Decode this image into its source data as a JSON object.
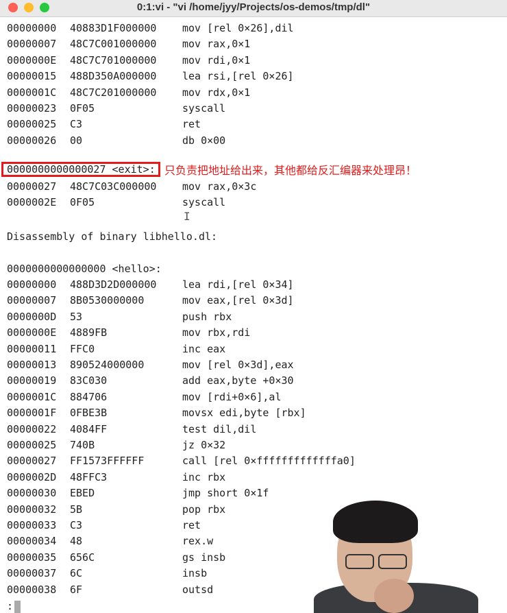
{
  "window": {
    "title": "0:1:vi - \"vi /home/jyy/Projects/os-demos/tmp/dl\""
  },
  "colors": {
    "close": "#fe5f57",
    "minimize": "#febc2e",
    "maximize": "#28c840",
    "annotation": "#e21b1b"
  },
  "section1_rows": [
    {
      "addr": "00000000",
      "bytes": "40883D1F000000",
      "asm": "mov [rel 0×26],dil"
    },
    {
      "addr": "00000007",
      "bytes": "48C7C001000000",
      "asm": "mov rax,0×1"
    },
    {
      "addr": "0000000E",
      "bytes": "48C7C701000000",
      "asm": "mov rdi,0×1"
    },
    {
      "addr": "00000015",
      "bytes": "488D350A000000",
      "asm": "lea rsi,[rel 0×26]"
    },
    {
      "addr": "0000001C",
      "bytes": "48C7C201000000",
      "asm": "mov rdx,0×1"
    },
    {
      "addr": "00000023",
      "bytes": "0F05",
      "asm": "syscall"
    },
    {
      "addr": "00000025",
      "bytes": "C3",
      "asm": "ret"
    },
    {
      "addr": "00000026",
      "bytes": "00",
      "asm": "db 0×00"
    }
  ],
  "exit_label": "0000000000000027 <exit>:",
  "annotation": "只负责把地址给出来，其他都给反汇编器来处理昂！",
  "section2_rows": [
    {
      "addr": "00000027",
      "bytes": "48C7C03C000000",
      "asm": "mov rax,0×3c"
    },
    {
      "addr": "0000002E",
      "bytes": "0F05",
      "asm": "syscall"
    }
  ],
  "disasm_header": "Disassembly of binary libhello.dl:",
  "hello_label": "0000000000000000 <hello>:",
  "hello_rows": [
    {
      "addr": "00000000",
      "bytes": "488D3D2D000000",
      "asm": "lea rdi,[rel 0×34]"
    },
    {
      "addr": "00000007",
      "bytes": "8B0530000000",
      "asm": "mov eax,[rel 0×3d]"
    },
    {
      "addr": "0000000D",
      "bytes": "53",
      "asm": "push rbx"
    },
    {
      "addr": "0000000E",
      "bytes": "4889FB",
      "asm": "mov rbx,rdi"
    },
    {
      "addr": "00000011",
      "bytes": "FFC0",
      "asm": "inc eax"
    },
    {
      "addr": "00000013",
      "bytes": "890524000000",
      "asm": "mov [rel 0×3d],eax"
    },
    {
      "addr": "00000019",
      "bytes": "83C030",
      "asm": "add eax,byte +0×30"
    },
    {
      "addr": "0000001C",
      "bytes": "884706",
      "asm": "mov [rdi+0×6],al"
    },
    {
      "addr": "0000001F",
      "bytes": "0FBE3B",
      "asm": "movsx edi,byte [rbx]"
    },
    {
      "addr": "00000022",
      "bytes": "4084FF",
      "asm": "test dil,dil"
    },
    {
      "addr": "00000025",
      "bytes": "740B",
      "asm": "jz 0×32"
    },
    {
      "addr": "00000027",
      "bytes": "FF1573FFFFFF",
      "asm": "call [rel 0×fffffffffffffa0]"
    },
    {
      "addr": "0000002D",
      "bytes": "48FFC3",
      "asm": "inc rbx"
    },
    {
      "addr": "00000030",
      "bytes": "EBED",
      "asm": "jmp short 0×1f"
    },
    {
      "addr": "00000032",
      "bytes": "5B",
      "asm": "pop rbx"
    },
    {
      "addr": "00000033",
      "bytes": "C3",
      "asm": "ret"
    },
    {
      "addr": "00000034",
      "bytes": "48",
      "asm": "rex.w"
    },
    {
      "addr": "00000035",
      "bytes": "656C",
      "asm": "gs insb"
    },
    {
      "addr": "00000037",
      "bytes": "6C",
      "asm": "insb"
    },
    {
      "addr": "00000038",
      "bytes": "6F",
      "asm": "outsd"
    }
  ],
  "prompt": ":"
}
